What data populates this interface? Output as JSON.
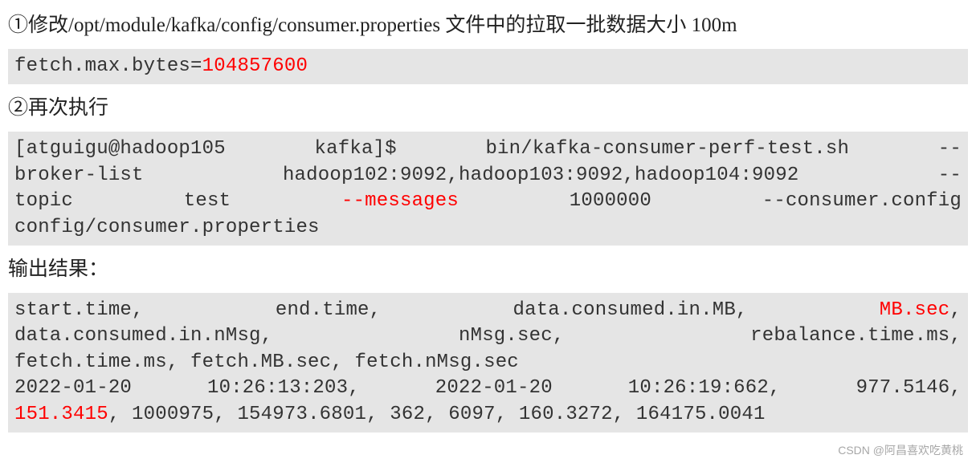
{
  "para1": {
    "circled": "①",
    "text_a": "修改/opt/module/kafka/config/consumer.properties 文件中的拉取一批数据大小 100m"
  },
  "code1": {
    "prefix": "fetch.max.bytes=",
    "value": "104857600"
  },
  "para2": {
    "circled": "②",
    "text": "再次执行"
  },
  "code2": {
    "l1_a": "[atguigu@hadoop105 ",
    "l1_b": "kafka]$ ",
    "l1_c": "bin/kafka-consumer-perf-test.sh ",
    "l1_d": "--",
    "l2_a": "broker-list ",
    "l2_b": "hadoop102:9092,hadoop103:9092,hadoop104:9092 ",
    "l2_c": "--",
    "l3_a": "topic ",
    "l3_b": "test ",
    "l3_c": "--messages",
    "l3_d": " 1000000 ",
    "l3_e": "--consumer.config",
    "l4": "config/consumer.properties"
  },
  "para3": "输出结果：",
  "code3": {
    "l1_a": "start.time, ",
    "l1_b": "end.time, ",
    "l1_c": "data.consumed.in.MB, ",
    "l1_d": "MB.sec",
    "l1_e": ",",
    "l2_a": "data.consumed.in.nMsg, ",
    "l2_b": "nMsg.sec, ",
    "l2_c": "rebalance.time.ms,",
    "l3": "fetch.time.ms, fetch.MB.sec, fetch.nMsg.sec",
    "l4_a": "2022-01-20 ",
    "l4_b": "10:26:13:203, ",
    "l4_c": "2022-01-20 ",
    "l4_d": "10:26:19:662, ",
    "l4_e": "977.5146,",
    "l5_a": "151.3415",
    "l5_b": ", 1000975, 154973.6801, 362, 6097, 160.3272, 164175.0041"
  },
  "watermark": "CSDN @阿昌喜欢吃黄桃"
}
